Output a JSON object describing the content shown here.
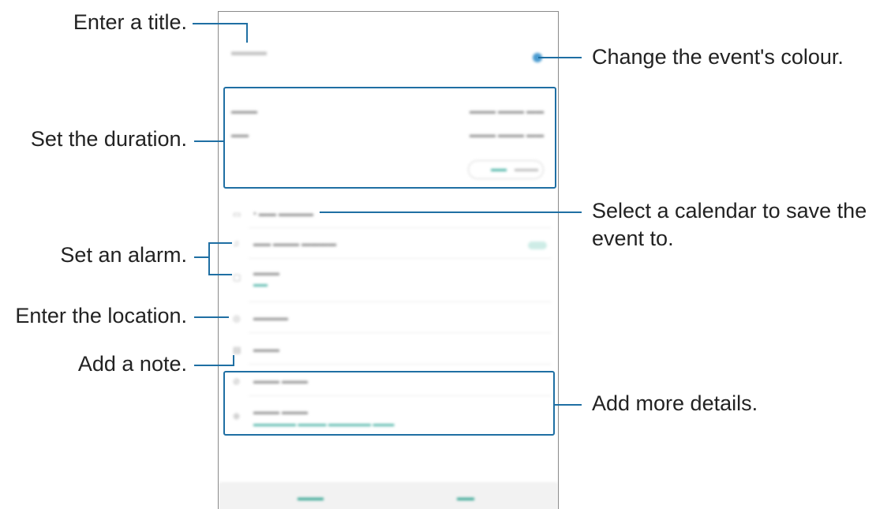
{
  "callouts": {
    "title": "Enter a title.",
    "duration": "Set the duration.",
    "alarm": "Set an alarm.",
    "location": "Enter the location.",
    "note": "Add a note.",
    "colour": "Change the event's colour.",
    "calendar_line1": "Select a calendar to save the",
    "calendar_line2": "event to.",
    "details": "Add more details."
  },
  "colors": {
    "accent": "#1f6fa3",
    "event_colour": "#4a9bd0",
    "secondary_text": "#4fb5a8"
  },
  "icons": {
    "calendar": "calendar-icon",
    "bell": "bell-icon",
    "repeat": "repeat-icon",
    "location": "location-pin-icon",
    "note": "note-icon",
    "attachment": "paperclip-icon",
    "timezone": "globe-icon"
  }
}
